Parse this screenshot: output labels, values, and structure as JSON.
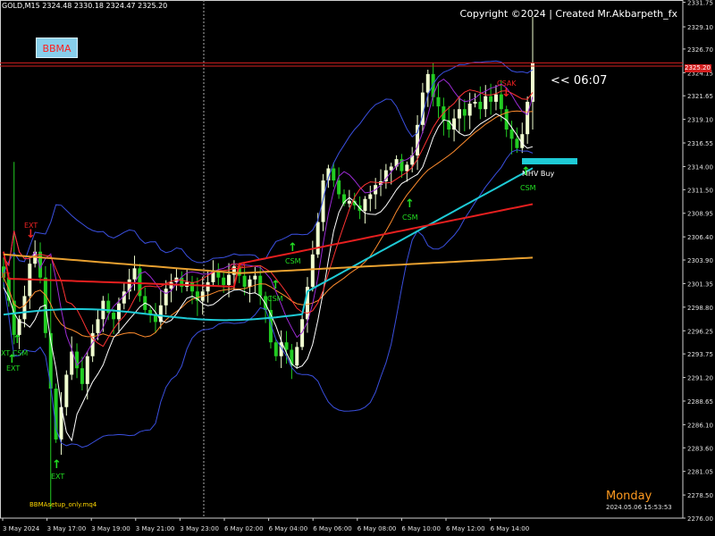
{
  "header": {
    "symbol": "GOLD,M15",
    "ohlc": "2324.48 2330.18 2324.47 2325.20",
    "copyright": "Copyright ©2024 | Created Mr.Akbarpeth_fx"
  },
  "bbma_button": "BBMA",
  "countdown": "<< 06:07",
  "footer": {
    "weekday": "Monday",
    "server_time": "2024.05.06 15:53:53",
    "ea_name": "BBMAsetup_only.mq4"
  },
  "price_tag": "2325.20",
  "signals": [
    {
      "text": "EXT",
      "color": "red"
    },
    {
      "text": "XT",
      "color": "red"
    },
    {
      "text": "XT CSM",
      "color": "green"
    },
    {
      "text": "EXT",
      "color": "green"
    },
    {
      "text": "EXT",
      "color": "green"
    },
    {
      "text": "CSM",
      "color": "red"
    },
    {
      "text": "CSM",
      "color": "green"
    },
    {
      "text": "CSM",
      "color": "green"
    },
    {
      "text": "CSM",
      "color": "green"
    },
    {
      "text": "CSAK",
      "color": "red"
    },
    {
      "text": "MHV Buy",
      "color": "white"
    },
    {
      "text": "CSM",
      "color": "green"
    }
  ],
  "colors": {
    "background": "#000000",
    "bull_candle": "#f0ffd0",
    "bear_candle": "#22cc22",
    "bb_bands": "#3a4fdf",
    "bb_mid": "#ff8c2e",
    "ma5_high": "#9b2bd4",
    "ma5_low": "#ffffff",
    "ma10": "#ff3333",
    "ema50": "#1ecbd6",
    "ma_red": "#e61f1f",
    "ma_orange": "#e8a030",
    "signal_green": "#22dd22",
    "signal_red": "#ee2222",
    "grid_vline": "#aaaaaa"
  },
  "chart_data": {
    "type": "candlestick",
    "symbol": "GOLD",
    "timeframe": "M15",
    "ylim": [
      2276.0,
      2332.0
    ],
    "y_ticks": [
      "2331.75",
      "2329.10",
      "2326.70",
      "2324.15",
      "2321.65",
      "2319.10",
      "2316.55",
      "2314.00",
      "2311.50",
      "2308.95",
      "2306.40",
      "2303.90",
      "2301.35",
      "2298.80",
      "2296.25",
      "2293.75",
      "2291.20",
      "2288.65",
      "2286.10",
      "2283.60",
      "2281.05",
      "2278.50",
      "2276.00"
    ],
    "x_ticks": [
      "3 May 2024",
      "3 May 17:00",
      "3 May 19:00",
      "3 May 21:00",
      "3 May 23:00",
      "6 May 02:00",
      "6 May 04:00",
      "6 May 06:00",
      "6 May 08:00",
      "6 May 10:00",
      "6 May 12:00",
      "6 May 14:00"
    ],
    "horizontal_lines": [
      2325.2,
      2324.85
    ],
    "current_price": 2325.2,
    "close_path": [
      2302.0,
      2299.5,
      2295.8,
      2297.5,
      2300.0,
      2303.5,
      2304.8,
      2302.0,
      2296.0,
      2290.0,
      2284.5,
      2288.0,
      2291.5,
      2294.0,
      2292.2,
      2290.5,
      2293.5,
      2296.0,
      2297.5,
      2299.5,
      2298.2,
      2297.5,
      2299.2,
      2300.5,
      2301.8,
      2303.0,
      2300.0,
      2298.5,
      2298.0,
      2297.2,
      2299.0,
      2300.8,
      2301.5,
      2302.0,
      2301.0,
      2301.5,
      2300.5,
      2299.5,
      2300.5,
      2301.5,
      2302.8,
      2302.0,
      2301.2,
      2302.3,
      2303.2,
      2302.2,
      2301.0,
      2301.8,
      2302.2,
      2300.0,
      2298.5,
      2295.0,
      2293.5,
      2295.0,
      2294.2,
      2292.5,
      2294.5,
      2297.5,
      2301.0,
      2304.5,
      2308.0,
      2312.5,
      2313.8,
      2312.5,
      2311.0,
      2310.0,
      2310.3,
      2309.8,
      2309.2,
      2310.5,
      2311.0,
      2312.0,
      2312.4,
      2313.6,
      2314.0,
      2314.8,
      2313.5,
      2314.2,
      2315.2,
      2318.5,
      2322.0,
      2324.0,
      2321.5,
      2320.5,
      2319.0,
      2318.0,
      2319.2,
      2320.2,
      2319.5,
      2320.8,
      2321.0,
      2320.2,
      2321.6,
      2321.0,
      2321.8,
      2320.2,
      2318.0,
      2317.0,
      2316.0,
      2317.5,
      2321.0,
      2325.2
    ],
    "series": [
      {
        "name": "BBMA",
        "indicator": "bollinger_bands"
      },
      {
        "name": "CSM",
        "indicator": "signal"
      },
      {
        "name": "CSAK",
        "indicator": "signal"
      },
      {
        "name": "EXT",
        "indicator": "signal"
      },
      {
        "name": "MHV Buy",
        "indicator": "signal"
      }
    ]
  }
}
